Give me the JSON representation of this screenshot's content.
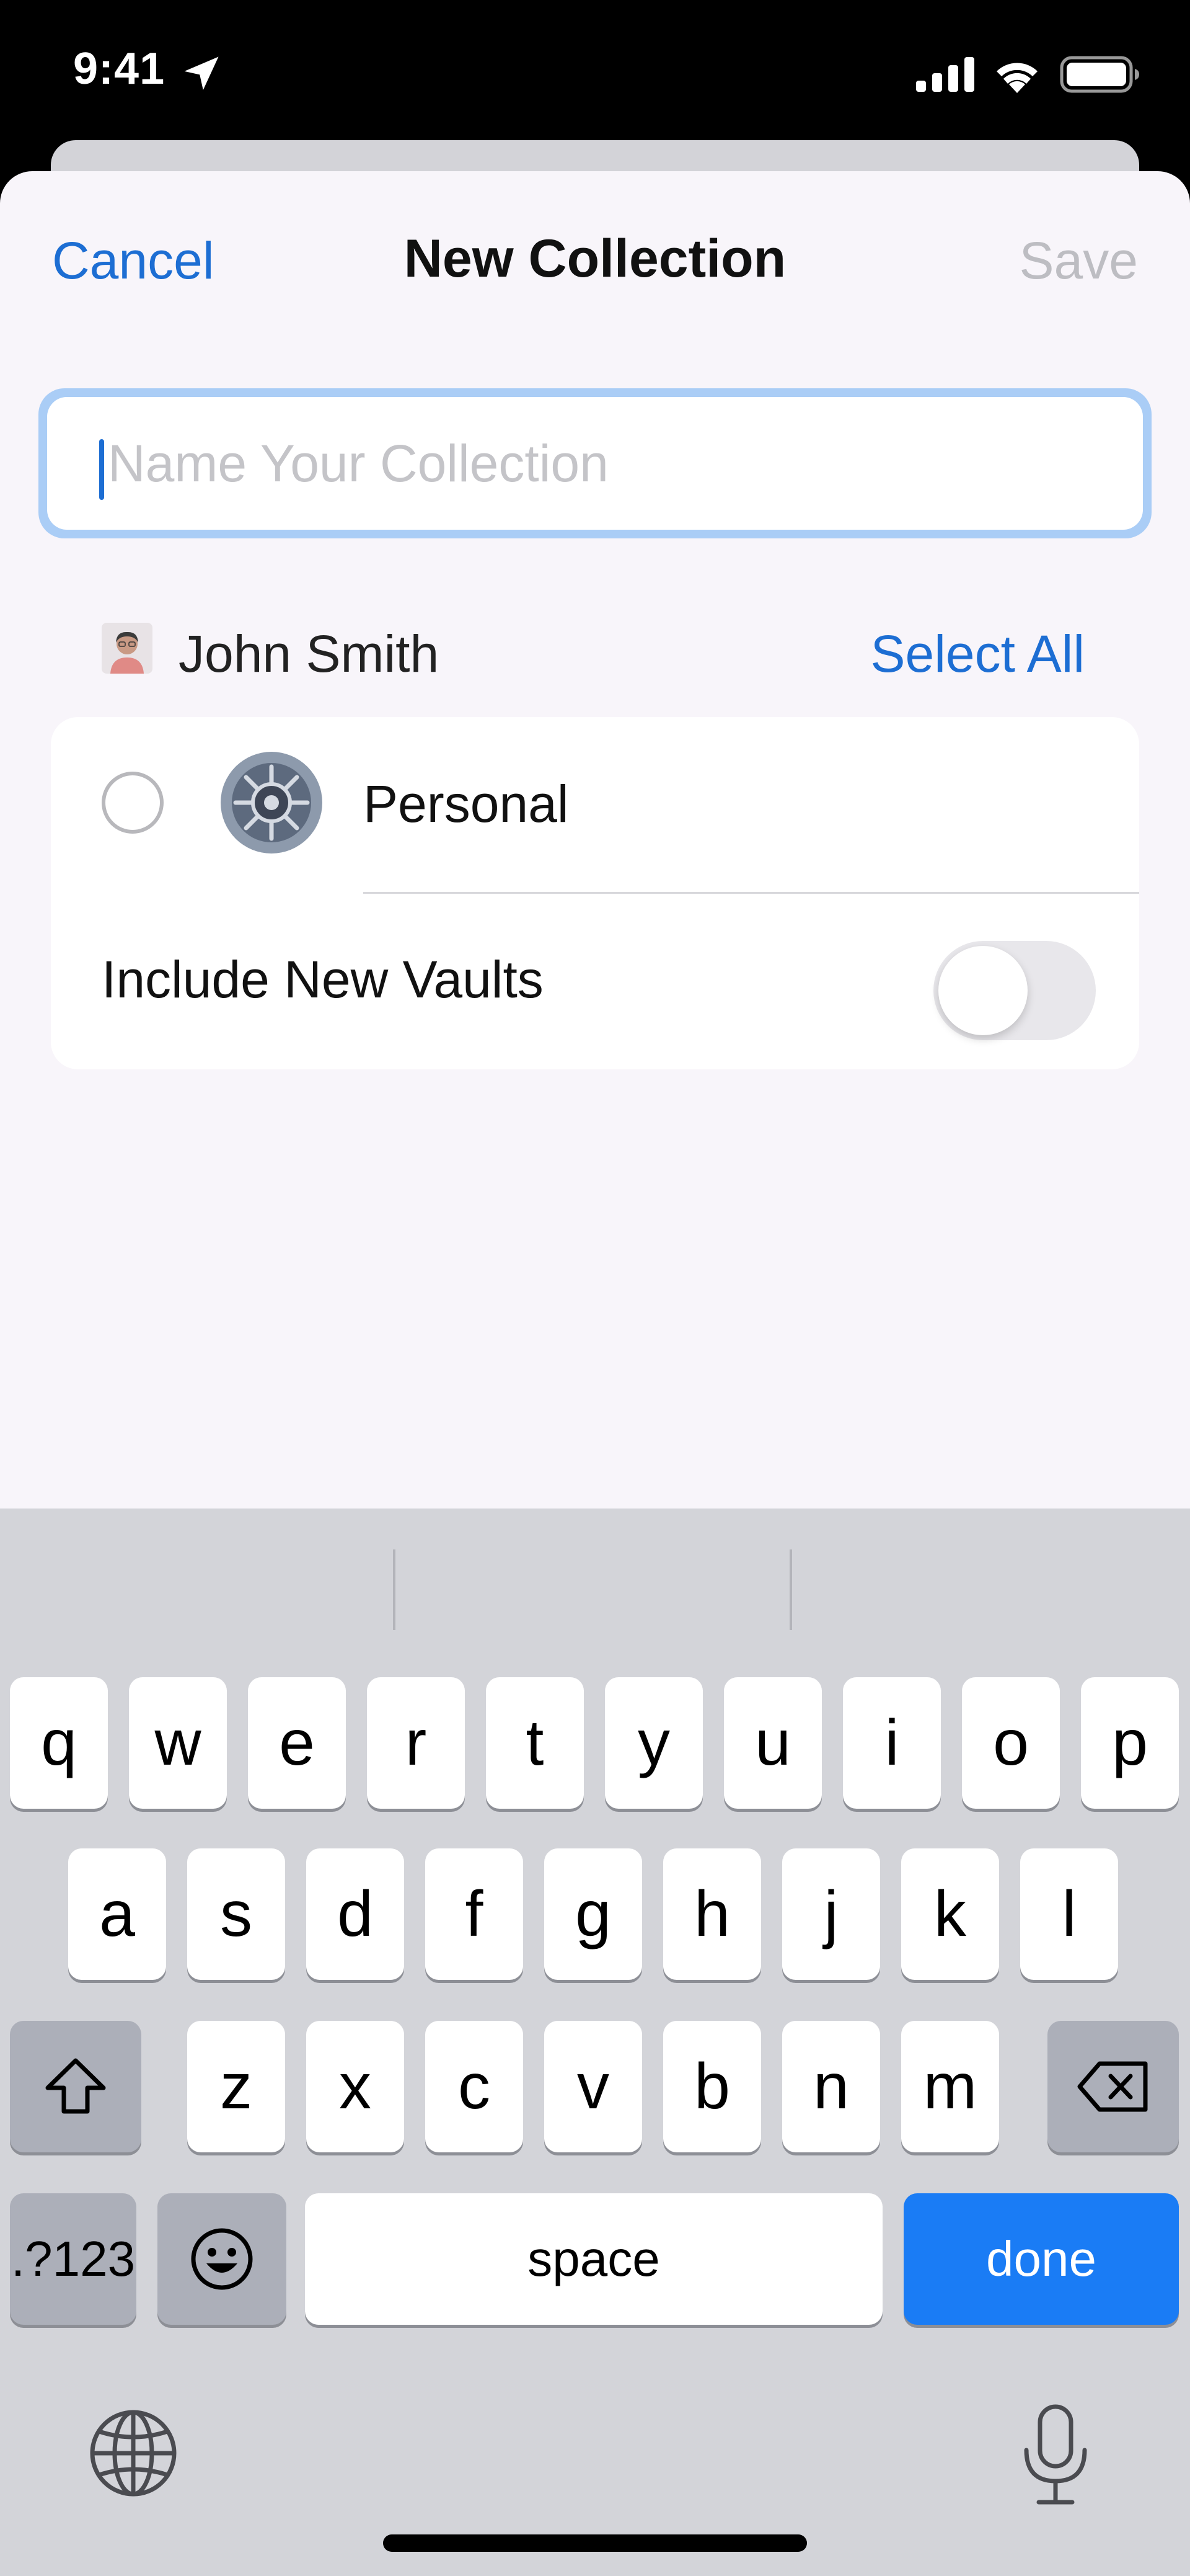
{
  "status_bar": {
    "time": "9:41"
  },
  "nav": {
    "cancel": "Cancel",
    "title": "New Collection",
    "save": "Save"
  },
  "name_field": {
    "placeholder": "Name Your Collection",
    "value": ""
  },
  "account": {
    "name": "John Smith",
    "select_all": "Select All"
  },
  "vaults": [
    {
      "label": "Personal",
      "selected": false
    }
  ],
  "include_new_vaults": {
    "label": "Include New Vaults",
    "enabled": false
  },
  "keyboard": {
    "row1": [
      "q",
      "w",
      "e",
      "r",
      "t",
      "y",
      "u",
      "i",
      "o",
      "p"
    ],
    "row2": [
      "a",
      "s",
      "d",
      "f",
      "g",
      "h",
      "j",
      "k",
      "l"
    ],
    "row3": [
      "z",
      "x",
      "c",
      "v",
      "b",
      "n",
      "m"
    ],
    "numbers": ".?123",
    "space": "space",
    "done": "done"
  },
  "colors": {
    "accent": "#1d6ed3",
    "done_key": "#1a7cf5",
    "sheet_bg": "#f8f5fa"
  },
  "icons": [
    "location-arrow-icon",
    "cellular-signal-icon",
    "wifi-icon",
    "battery-icon",
    "avatar",
    "vault-icon",
    "shift-icon",
    "delete-icon",
    "emoji-icon",
    "globe-icon",
    "microphone-icon"
  ]
}
